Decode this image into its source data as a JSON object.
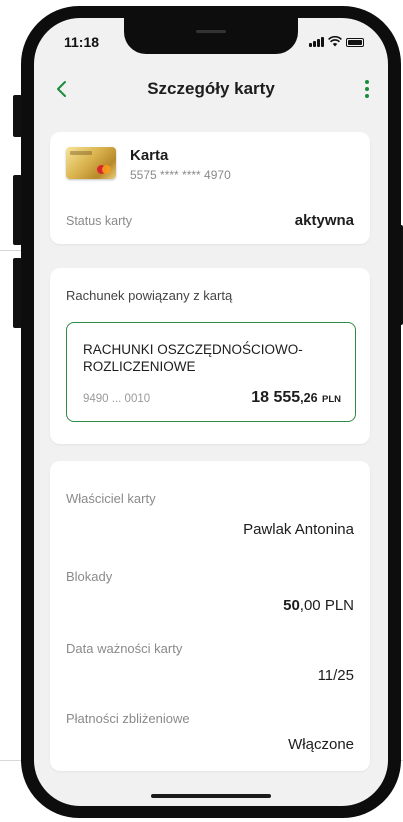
{
  "status_bar": {
    "time": "11:18"
  },
  "header": {
    "title": "Szczegóły karty"
  },
  "card": {
    "name": "Karta",
    "number": "5575 **** **** 4970",
    "status_label": "Status karty",
    "status_value": "aktywna"
  },
  "linked_account": {
    "label": "Rachunek powiązany z kartą",
    "name": "RACHUNKI OSZCZĘDNOŚCIOWO-ROZLICZENIOWE",
    "number": "9490 ... 0010",
    "balance_int": "18 555",
    "balance_dec": ",26",
    "currency": "PLN"
  },
  "details": {
    "owner_label": "Właściciel karty",
    "owner_value": "Pawlak Antonina",
    "blocks_label": "Blokady",
    "blocks_int": "50",
    "blocks_rest": ",00 PLN",
    "expiry_label": "Data ważności karty",
    "expiry_value": "11/25",
    "contactless_label": "Płatności zbliżeniowe",
    "contactless_value": "Włączone"
  },
  "colors": {
    "accent": "#1a8c3a",
    "account_border": "#2e8a47"
  },
  "icons": [
    "back-arrow-icon",
    "more-vertical-icon",
    "signal-icon",
    "wifi-icon",
    "battery-icon",
    "card-image"
  ]
}
